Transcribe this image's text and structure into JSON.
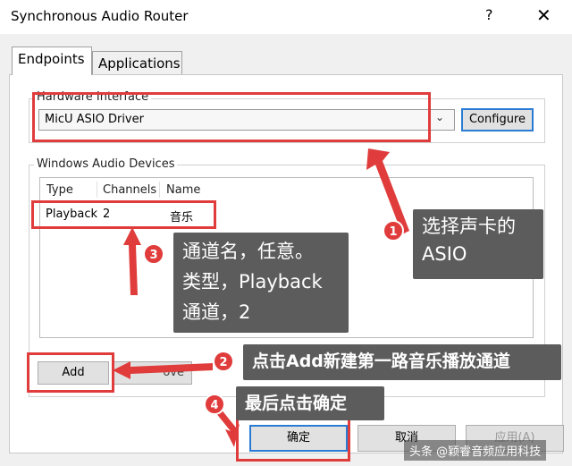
{
  "window": {
    "title": "Synchronous Audio Router",
    "help_symbol": "?",
    "close_symbol": "✕"
  },
  "tabs": [
    {
      "label": "Endpoints",
      "active": true
    },
    {
      "label": "Applications",
      "active": false
    }
  ],
  "hardware": {
    "group_title": "Hardware Interface",
    "selected_driver": "MicU ASIO Driver",
    "configure_label": "Configure"
  },
  "devices": {
    "group_title": "Windows Audio Devices",
    "columns": [
      "Type",
      "Channels",
      "Name"
    ],
    "rows": [
      {
        "type": "Playback",
        "channels": "2",
        "name": "音乐"
      }
    ],
    "add_label": "Add",
    "remove_label_partial": "ove"
  },
  "footer": {
    "ok_label": "确定",
    "cancel_label": "取消",
    "apply_label": "应用(A)"
  },
  "annotations": [
    {
      "number": "1",
      "text_line1": "选择声卡的",
      "text_line2": "ASIO"
    },
    {
      "number": "2",
      "text": "点击Add新建第一路音乐播放通道"
    },
    {
      "number": "3",
      "text_line1": "通道名，任意。",
      "text_line2": "类型，Playback",
      "text_line3": "通道，2"
    },
    {
      "number": "4",
      "text": "最后点击确定"
    }
  ],
  "watermark": "头条 @颖睿音频应用科技",
  "colors": {
    "annotation_red": "#e03c3c",
    "callout_bg": "#5c5c5c",
    "focus_blue": "#2a7bd4"
  }
}
